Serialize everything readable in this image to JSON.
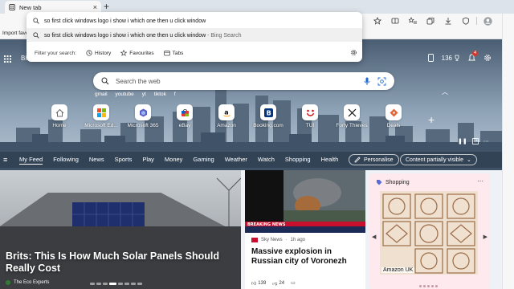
{
  "tab": {
    "title": "New tab"
  },
  "favbar": {
    "label": "Import favo"
  },
  "omnibox": {
    "query": "so first click windows logo i show i which one then u click window",
    "suggestion": "so first click windows logo i show i which one then u click window",
    "suggestion_source": " - Bing Search",
    "filter_label": "Filter your search:",
    "filters": [
      "History",
      "Favourites",
      "Tabs"
    ]
  },
  "page": {
    "brand": "Bing",
    "rewards_points": "136",
    "notification_count": "4"
  },
  "search": {
    "placeholder": "Search the web",
    "quick_links": [
      "gmail",
      "youtube",
      "yt",
      "tiktok",
      "f"
    ]
  },
  "tiles": [
    {
      "label": "Home",
      "icon": "home-icon",
      "color": "#6b6b6b"
    },
    {
      "label": "Microsoft Ed...",
      "icon": "microsoft-logo-icon",
      "color": "#f25022"
    },
    {
      "label": "Microsoft 365",
      "icon": "m365-icon",
      "color": "#5b5fc7"
    },
    {
      "label": "eBay",
      "icon": "ebay-icon",
      "color": "#e53238"
    },
    {
      "label": "Amazon",
      "icon": "amazon-icon",
      "color": "#111111"
    },
    {
      "label": "Booking.com",
      "icon": "booking-icon",
      "color": "#003580"
    },
    {
      "label": "TUI",
      "icon": "tui-icon",
      "color": "#d40e14"
    },
    {
      "label": "Forty Thieves",
      "icon": "swords-icon",
      "color": "#111111"
    },
    {
      "label": "Deals",
      "icon": "tag-icon",
      "color": "#e0673a"
    }
  ],
  "nav": {
    "items": [
      "My Feed",
      "Following",
      "News",
      "Sports",
      "Play",
      "Money",
      "Gaming",
      "Weather",
      "Watch",
      "Shopping",
      "Health"
    ],
    "personalise": "Personalise",
    "visibility": "Content partially visible"
  },
  "feed": {
    "main": {
      "title": "Brits: This Is How Much Solar Panels Should Really Cost",
      "source": "The Eco Experts"
    },
    "news": {
      "source": "Sky News",
      "age": "1h ago",
      "title": "Massive explosion in Russian city of Voronezh",
      "likes": "139",
      "comments": "24",
      "breaking": "BREAKING NEWS"
    },
    "shopping": {
      "header": "Shopping",
      "product_label": "Amazon UK"
    }
  }
}
